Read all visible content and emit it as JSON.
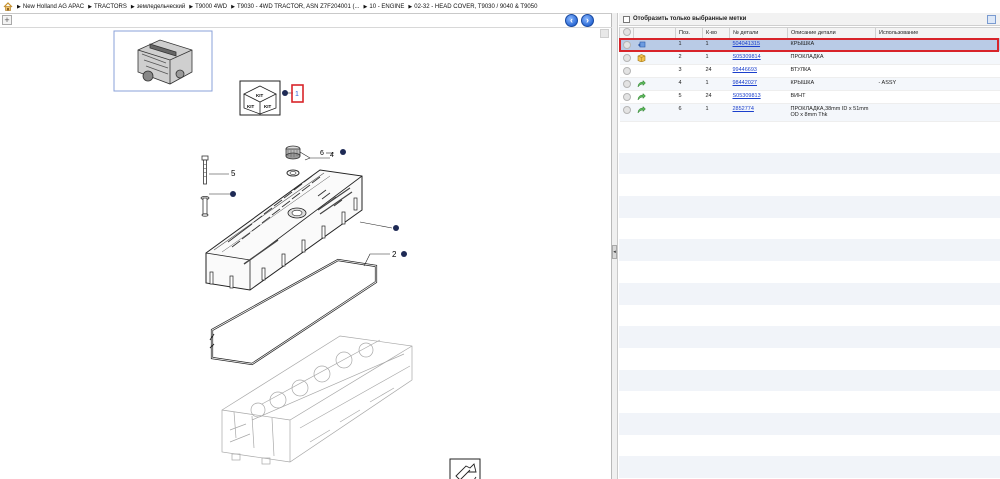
{
  "breadcrumb": {
    "items": [
      {
        "label": "New Holland AG APAC"
      },
      {
        "label": "TRACTORS"
      },
      {
        "label": "земледельческий"
      },
      {
        "label": "T9000 4WD"
      },
      {
        "label": "T9030 - 4WD TRACTOR, ASN Z7F204001 (..."
      },
      {
        "label": "10 - ENGINE"
      },
      {
        "label": "02-32 - HEAD COVER,  T9030 / 9040 & T9050"
      }
    ]
  },
  "left_pane": {
    "zoom_label": "+",
    "nav_prev": "‹",
    "nav_next": "›",
    "callouts": {
      "c1": "1",
      "c2": "2",
      "c4": "4",
      "c5": "5",
      "c6": "6"
    },
    "kit_label": "KIT"
  },
  "splitter": {
    "handle_label": "◂"
  },
  "right_pane": {
    "filter_label": "Отобразить только выбранные метки",
    "columns": [
      "",
      "",
      "Поз.",
      "К-во",
      "№ детали",
      "Описание детали",
      "Использование"
    ],
    "rows": [
      {
        "pos": "1",
        "qty": "1",
        "part": "504041315",
        "desc": "КРЫШКА",
        "usage": "",
        "status": "shipping",
        "selected": true
      },
      {
        "pos": "2",
        "qty": "1",
        "part": "S05309814",
        "desc": "ПРОКЛАДКА",
        "usage": "",
        "status": "box",
        "selected": false
      },
      {
        "pos": "3",
        "qty": "24",
        "part": "99446693",
        "desc": "ВТУЛКА",
        "usage": "",
        "status": "none",
        "selected": false
      },
      {
        "pos": "4",
        "qty": "1",
        "part": "98442027",
        "desc": "КРЫШКА",
        "usage": "- ASSY",
        "status": "arrow",
        "selected": false
      },
      {
        "pos": "5",
        "qty": "24",
        "part": "S05309813",
        "desc": "ВИНТ",
        "usage": "",
        "status": "arrow",
        "selected": false
      },
      {
        "pos": "6",
        "qty": "1",
        "part": "2852774",
        "desc": "ПРОКЛАДКА,38mm ID x 51mm OD x 8mm Thk",
        "usage": "",
        "status": "arrow",
        "selected": false
      }
    ]
  },
  "colors": {
    "selected_row": "#b9cbe6",
    "highlight_border": "#d8242a",
    "link": "#1a3fcc",
    "nav_blue": "#2d6bd6"
  }
}
